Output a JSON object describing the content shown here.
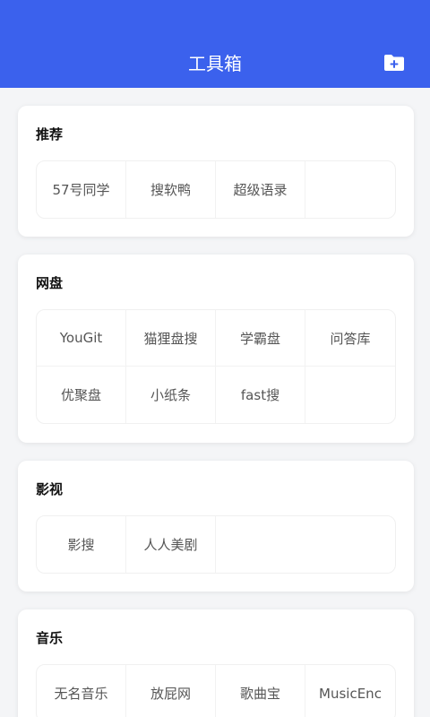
{
  "header": {
    "title": "工具箱",
    "add_icon": "folder-plus-icon",
    "color": "#3b61ed"
  },
  "sections": [
    {
      "title": "推荐",
      "items": [
        "57号同学",
        "搜软鸭",
        "超级语录"
      ]
    },
    {
      "title": "网盘",
      "items": [
        "YouGit",
        "猫狸盘搜",
        "学霸盘",
        "问答库",
        "优聚盘",
        "小纸条",
        "fast搜"
      ]
    },
    {
      "title": "影视",
      "items": [
        "影搜",
        "人人美剧"
      ]
    },
    {
      "title": "音乐",
      "items": [
        "无名音乐",
        "放屁网",
        "歌曲宝",
        "MusicEnc"
      ]
    }
  ]
}
